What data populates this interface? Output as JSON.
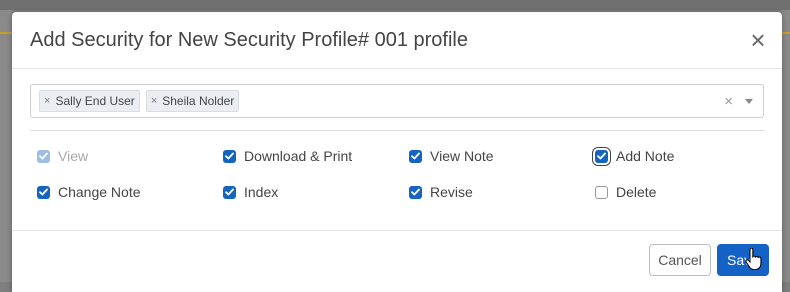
{
  "dialog": {
    "title": "Add Security for New Security Profile# 001 profile",
    "close_symbol": "×"
  },
  "users": {
    "selected": [
      {
        "label": "Sally End User",
        "remove_symbol": "×"
      },
      {
        "label": "Sheila Nolder",
        "remove_symbol": "×"
      }
    ],
    "clear_symbol": "×"
  },
  "permissions": [
    {
      "label": "View",
      "checked": true,
      "disabled": true
    },
    {
      "label": "Download & Print",
      "checked": true,
      "disabled": false
    },
    {
      "label": "View Note",
      "checked": true,
      "disabled": false
    },
    {
      "label": "Add Note",
      "checked": true,
      "disabled": false,
      "focused": true
    },
    {
      "label": "Change Note",
      "checked": true,
      "disabled": false
    },
    {
      "label": "Index",
      "checked": true,
      "disabled": false
    },
    {
      "label": "Revise",
      "checked": true,
      "disabled": false
    },
    {
      "label": "Delete",
      "checked": false,
      "disabled": false
    }
  ],
  "footer": {
    "cancel_label": "Cancel",
    "save_label": "Save"
  },
  "colors": {
    "primary": "#1562c7",
    "checkbox_checked": "#1565c0",
    "checkbox_disabled": "#9dbde3"
  },
  "icons": {
    "close": "close-icon",
    "checkmark": "checkmark-icon",
    "dropdown": "chevron-down-icon",
    "cursor": "hand-pointer-icon"
  }
}
